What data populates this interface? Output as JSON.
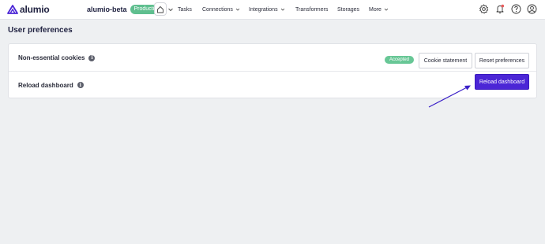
{
  "topbar": {
    "logo_text": "alumio",
    "environment": {
      "name": "alumio-beta",
      "badge": "Production"
    },
    "nav": [
      {
        "label": "Tasks",
        "has_chevron": false
      },
      {
        "label": "Connections",
        "has_chevron": true
      },
      {
        "label": "Integrations",
        "has_chevron": true
      },
      {
        "label": "Transformers",
        "has_chevron": false
      },
      {
        "label": "Storages",
        "has_chevron": false
      },
      {
        "label": "More",
        "has_chevron": true
      }
    ],
    "icons": [
      "home-icon",
      "gear-icon",
      "bell-icon",
      "help-icon",
      "user-icon"
    ]
  },
  "page": {
    "title": "User preferences"
  },
  "preferences": {
    "cookies": {
      "label": "Non-essential cookies",
      "status": "Accepted",
      "cookie_statement_label": "Cookie statement",
      "reset_label": "Reset preferences"
    },
    "reload": {
      "label": "Reload dashboard",
      "button_label": "Reload dashboard"
    }
  },
  "colors": {
    "brand": "#4b26d6",
    "accepted": "#68c796",
    "production": "#5fbf8f",
    "background": "#eef0f2"
  }
}
